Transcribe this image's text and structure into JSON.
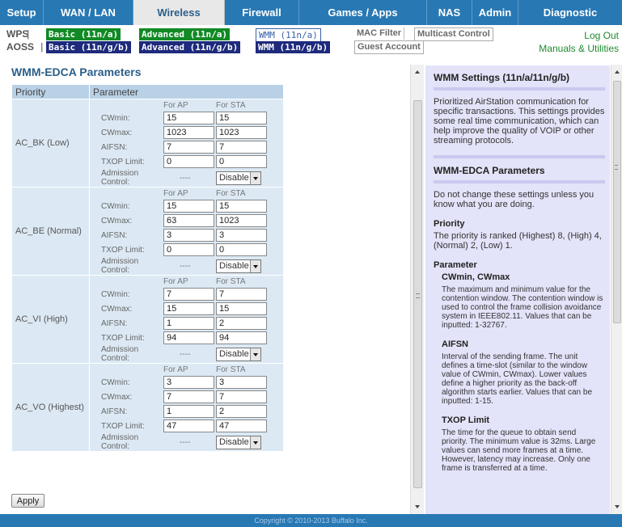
{
  "nav": {
    "tabs": [
      {
        "label": "Setup"
      },
      {
        "label": "WAN / LAN"
      },
      {
        "label": "Wireless"
      },
      {
        "label": "Firewall"
      },
      {
        "label": "Games / Apps"
      },
      {
        "label": "NAS"
      },
      {
        "label": "Admin"
      },
      {
        "label": "Diagnostic"
      }
    ],
    "active": "Wireless"
  },
  "subnav": {
    "wps": "WPS",
    "aoss": "AOSS",
    "basic_a": "Basic (11n/a)",
    "basic_g": "Basic (11n/g/b)",
    "adv_a": "Advanced (11n/a)",
    "adv_g": "Advanced (11n/g/b)",
    "wmm_a": "WMM (11n/a)",
    "wmm_g": "WMM (11n/g/b)",
    "mac_filter": "MAC Filter",
    "multicast": "Multicast Control",
    "guest": "Guest Account",
    "logout": "Log Out",
    "manuals": "Manuals & Utilities"
  },
  "main": {
    "title": "WMM-EDCA Parameters",
    "col_priority": "Priority",
    "col_parameter": "Parameter",
    "for_ap": "For AP",
    "for_sta": "For STA",
    "labels": {
      "cwmin": "CWmin:",
      "cwmax": "CWmax:",
      "aifsn": "AIFSN:",
      "txop": "TXOP Limit:",
      "admission": "Admission Control:"
    },
    "groups": [
      {
        "name": "AC_BK (Low)",
        "cwmin_ap": "15",
        "cwmin_sta": "15",
        "cwmax_ap": "1023",
        "cwmax_sta": "1023",
        "aifsn_ap": "7",
        "aifsn_sta": "7",
        "txop_ap": "0",
        "txop_sta": "0",
        "adm_ap": "----",
        "adm_sta": "Disable"
      },
      {
        "name": "AC_BE (Normal)",
        "cwmin_ap": "15",
        "cwmin_sta": "15",
        "cwmax_ap": "63",
        "cwmax_sta": "1023",
        "aifsn_ap": "3",
        "aifsn_sta": "3",
        "txop_ap": "0",
        "txop_sta": "0",
        "adm_ap": "----",
        "adm_sta": "Disable"
      },
      {
        "name": "AC_VI (High)",
        "cwmin_ap": "7",
        "cwmin_sta": "7",
        "cwmax_ap": "15",
        "cwmax_sta": "15",
        "aifsn_ap": "1",
        "aifsn_sta": "2",
        "txop_ap": "94",
        "txop_sta": "94",
        "adm_ap": "----",
        "adm_sta": "Disable"
      },
      {
        "name": "AC_VO (Highest)",
        "cwmin_ap": "3",
        "cwmin_sta": "3",
        "cwmax_ap": "7",
        "cwmax_sta": "7",
        "aifsn_ap": "1",
        "aifsn_sta": "2",
        "txop_ap": "47",
        "txop_sta": "47",
        "adm_ap": "----",
        "adm_sta": "Disable"
      }
    ],
    "apply": "Apply"
  },
  "help": {
    "h1": "WMM Settings (11n/a/11n/g/b)",
    "p1": "Prioritized AirStation communication for specific transactions. This settings provides some real time communication, which can help improve the quality of VOIP or other streaming protocols.",
    "h2": "WMM-EDCA Parameters",
    "p2": "Do not change these settings unless you know what you are doing.",
    "priority_h": "Priority",
    "priority_p": "The priority is ranked (Highest) 8, (High) 4, (Normal) 2, (Low) 1.",
    "parameter_h": "Parameter",
    "cw_h": "CWmin, CWmax",
    "cw_p": "The maximum and minimum value for the contention window. The contention window is used to control the frame collision avoidance system in IEEE802.11. Values that can be inputted: 1-32767.",
    "aifsn_h": "AIFSN",
    "aifsn_p": "Interval of the sending frame. The unit defines a time-slot (similar to the window value of CWmin, CWmax). Lower values define a higher priority as the back-off algorithm starts earlier. Values that can be inputted: 1-15.",
    "txop_h": "TXOP Limit",
    "txop_p": "The time for the queue to obtain send priority. The minimum value is 32ms. Large values can send more frames at a time. However, latency may increase. Only one frame is transferred at a time."
  },
  "footer": "Copyright © 2010-2013 Buffalo Inc."
}
